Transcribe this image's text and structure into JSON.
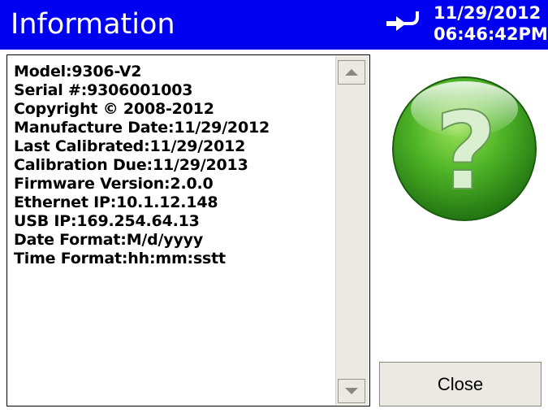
{
  "window": {
    "title": "Information",
    "date": "11/29/2012",
    "time": "06:46:42PM"
  },
  "info_lines": [
    "Model:9306-V2",
    "Serial #:9306001003",
    "Copyright © 2008-2012",
    "Manufacture Date:11/29/2012",
    "Last Calibrated:11/29/2012",
    "Calibration Due:11/29/2013",
    "Firmware Version:2.0.0",
    "Ethernet IP:10.1.12.148",
    "USB IP:169.254.64.13",
    "Date Format:M/d/yyyy",
    "Time Format:hh:mm:sstt"
  ],
  "buttons": {
    "close_label": "Close"
  },
  "icons": {
    "status": "plug-connected-icon",
    "help": "question-mark-icon",
    "scroll_up": "scroll-up-arrow-icon",
    "scroll_down": "scroll-down-arrow-icon"
  },
  "colors": {
    "titlebar": "#0000f0",
    "help_icon": "#3fae1f"
  }
}
